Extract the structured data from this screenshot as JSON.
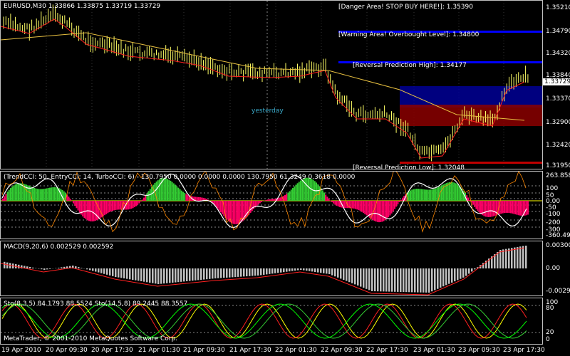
{
  "main": {
    "title": "EURUSD,M30  1.33866 1.33875 1.33719 1.33729",
    "price_scale": [
      "1.35210",
      "1.34790",
      "1.34320",
      "1.33840",
      "1.33370",
      "1.32900",
      "1.32420",
      "1.31950"
    ],
    "current_price": "1.33729",
    "annotations": {
      "danger": "[Danger Area! STOP BUY HERE!]: 1.35390",
      "warning": "[Warning Area! Overbought Level]: 1.34800",
      "rev_high": "[Reversal Prediction High]: 1.34177",
      "rev_low": "[Reversal Prediction Low]: 1.32048",
      "yesterday": "yesterday"
    },
    "colors": {
      "candles": "#ffff66",
      "ma_red": "#ff2020",
      "ma_yellow": "#e8c040",
      "danger_band": "#0000ff",
      "low_band": "#8b0000"
    }
  },
  "cci": {
    "title": "(TrendCCI: 50, EntryCCI: 14, TurboCCI: 6) - 130.7950 0.0000 0.0000 0.0000 130.7950 61.3249 0.3618 0.0000",
    "scale": [
      "263.8585",
      "100",
      "50",
      "0.00",
      "-50",
      "-100",
      "-200",
      "-300",
      "-360.494"
    ]
  },
  "macd": {
    "title": "MACD(9,20,6) 0.002529 0.002592",
    "scale": [
      "0.003005",
      "0.00",
      "-0.00294"
    ]
  },
  "sto": {
    "title": "Sto(8,3,5) 84.1793 88.5524  Sto(14,5,8) 89.2445 88.3557",
    "scale": [
      "100",
      "80",
      "20",
      "0"
    ],
    "copyright": "MetaTrader, © 2001-2010 MetaQuotes Software Corp."
  },
  "time_axis": [
    "19 Apr 2010",
    "20 Apr 09:30",
    "20 Apr 17:30",
    "21 Apr 01:30",
    "21 Apr 09:30",
    "21 Apr 17:30",
    "22 Apr 01:30",
    "22 Apr 09:30",
    "22 Apr 17:30",
    "23 Apr 01:30",
    "23 Apr 09:30",
    "23 Apr 17:30"
  ]
}
